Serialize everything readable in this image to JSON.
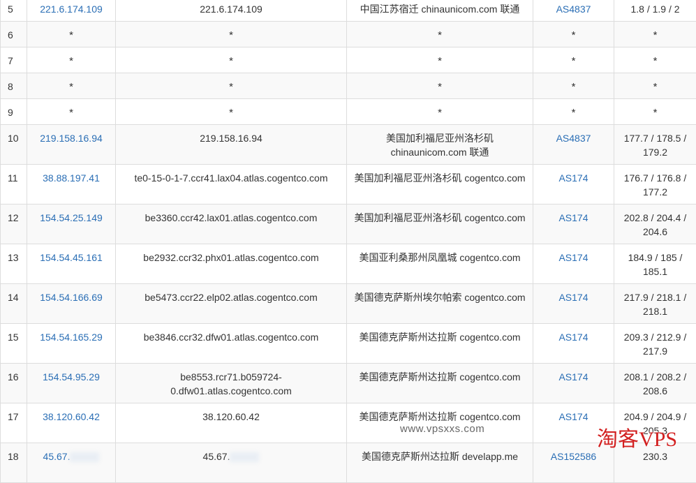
{
  "rows": [
    {
      "hop": "5",
      "ip": "221.6.174.109",
      "host": "221.6.174.109",
      "loc": "中国江苏宿迁 chinaunicom.com 联通",
      "as": "AS4837",
      "rtt": "1.8 / 1.9 / 2"
    },
    {
      "hop": "6",
      "ip": "*",
      "host": "*",
      "loc": "*",
      "as": "*",
      "rtt": "*"
    },
    {
      "hop": "7",
      "ip": "*",
      "host": "*",
      "loc": "*",
      "as": "*",
      "rtt": "*"
    },
    {
      "hop": "8",
      "ip": "*",
      "host": "*",
      "loc": "*",
      "as": "*",
      "rtt": "*"
    },
    {
      "hop": "9",
      "ip": "*",
      "host": "*",
      "loc": "*",
      "as": "*",
      "rtt": "*"
    },
    {
      "hop": "10",
      "ip": "219.158.16.94",
      "host": "219.158.16.94",
      "loc": "美国加利福尼亚州洛杉矶 chinaunicom.com 联通",
      "as": "AS4837",
      "rtt": "177.7 / 178.5 / 179.2"
    },
    {
      "hop": "11",
      "ip": "38.88.197.41",
      "host": "te0-15-0-1-7.ccr41.lax04.atlas.cogentco.com",
      "loc": "美国加利福尼亚州洛杉矶 cogentco.com",
      "as": "AS174",
      "rtt": "176.7 / 176.8 / 177.2"
    },
    {
      "hop": "12",
      "ip": "154.54.25.149",
      "host": "be3360.ccr42.lax01.atlas.cogentco.com",
      "loc": "美国加利福尼亚州洛杉矶 cogentco.com",
      "as": "AS174",
      "rtt": "202.8 / 204.4 / 204.6"
    },
    {
      "hop": "13",
      "ip": "154.54.45.161",
      "host": "be2932.ccr32.phx01.atlas.cogentco.com",
      "loc": "美国亚利桑那州凤凰城 cogentco.com",
      "as": "AS174",
      "rtt": "184.9 / 185 / 185.1"
    },
    {
      "hop": "14",
      "ip": "154.54.166.69",
      "host": "be5473.ccr22.elp02.atlas.cogentco.com",
      "loc": "美国德克萨斯州埃尔帕索 cogentco.com",
      "as": "AS174",
      "rtt": "217.9 / 218.1 / 218.1"
    },
    {
      "hop": "15",
      "ip": "154.54.165.29",
      "host": "be3846.ccr32.dfw01.atlas.cogentco.com",
      "loc": "美国德克萨斯州达拉斯 cogentco.com",
      "as": "AS174",
      "rtt": "209.3 / 212.9 / 217.9"
    },
    {
      "hop": "16",
      "ip": "154.54.95.29",
      "host": "be8553.rcr71.b059724-0.dfw01.atlas.cogentco.com",
      "loc": "美国德克萨斯州达拉斯 cogentco.com",
      "as": "AS174",
      "rtt": "208.1 / 208.2 / 208.6"
    },
    {
      "hop": "17",
      "ip": "38.120.60.42",
      "host": "38.120.60.42",
      "loc": "美国德克萨斯州达拉斯 cogentco.com",
      "as": "AS174",
      "rtt": "204.9 / 204.9 / 205.3"
    },
    {
      "hop": "18",
      "ip": "45.67.",
      "host": "45.67.",
      "loc": "美国德克萨斯州达拉斯 develapp.me",
      "as": "AS152586",
      "rtt": "230.3"
    }
  ],
  "watermark_url": "www.vpsxxs.com",
  "watermark_brand": "淘客VPS"
}
